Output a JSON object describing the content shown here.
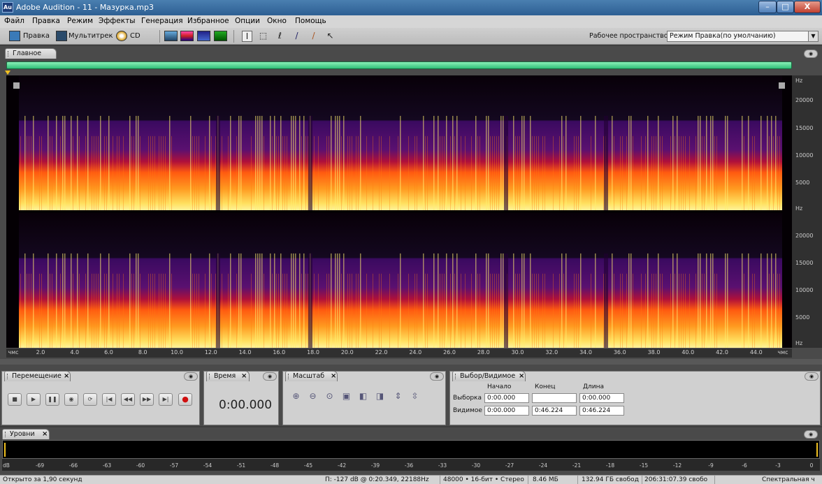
{
  "window": {
    "app_icon": "Au",
    "title": "Adobe Audition - 11 - Мазурка.mp3",
    "minimize": "–",
    "maximize": "□",
    "close": "X"
  },
  "menu": [
    "Файл",
    "Правка",
    "Режим",
    "Эффекты",
    "Генерация",
    "Избранное",
    "Опции",
    "Окно",
    "Помощь"
  ],
  "toolbar": {
    "edit_label": "Правка",
    "multitrack_label": "Мультитрек",
    "cd_label": "CD",
    "workspace_label": "Рабочее пространство:",
    "workspace_value": "Режим Правка(по умолчанию)"
  },
  "main_tab": {
    "label": "Главное"
  },
  "spectrogram": {
    "hz_unit": "Hz",
    "hz_labels": [
      "20000",
      "15000",
      "10000",
      "5000"
    ],
    "time_unit": "чмс",
    "time_ticks": [
      "2.0",
      "4.0",
      "6.0",
      "8.0",
      "10.0",
      "12.0",
      "14.0",
      "16.0",
      "18.0",
      "20.0",
      "22.0",
      "24.0",
      "26.0",
      "28.0",
      "30.0",
      "32.0",
      "34.0",
      "36.0",
      "38.0",
      "40.0",
      "42.0",
      "44.0"
    ],
    "colors": {
      "background": "#040004",
      "high": "#ffef70",
      "mid": "#ff7a10",
      "low": "#b0103a",
      "faint": "#3a0a60"
    }
  },
  "transport": {
    "tab_label": "Перемещение",
    "buttons": [
      "stop",
      "play",
      "pause",
      "play-from-cursor",
      "loop",
      "to-start",
      "rewind",
      "fast-forward",
      "to-end",
      "record"
    ]
  },
  "time_panel": {
    "tab_label": "Время",
    "value": "0:00.000"
  },
  "zoom_panel": {
    "tab_label": "Масштаб"
  },
  "selection_panel": {
    "tab_label": "Выбор/Видимое",
    "col_start": "Начало",
    "col_end": "Конец",
    "col_length": "Длина",
    "row_selection": "Выборка",
    "row_visible": "Видимое",
    "sel_start": "0:00.000",
    "sel_end": "",
    "sel_length": "0:00.000",
    "vis_start": "0:00.000",
    "vis_end": "0:46.224",
    "vis_length": "0:46.224"
  },
  "levels": {
    "tab_label": "Уровни",
    "db_labels": [
      "dB",
      "-69",
      "-66",
      "-63",
      "-60",
      "-57",
      "-54",
      "-51",
      "-48",
      "-45",
      "-42",
      "-39",
      "-36",
      "-33",
      "-30",
      "-27",
      "-24",
      "-21",
      "-18",
      "-15",
      "-12",
      "-9",
      "-6",
      "-3",
      "0"
    ]
  },
  "status": {
    "left": "Открыто за 1,90 секунд",
    "cursor": "П: -127 dB @  0:20.349, 22188Hz",
    "format": "48000 • 16-бит • Стерео",
    "size": "8.46 МБ",
    "free": "132.94 ГБ свобод",
    "free_time": "206:31:07.39 свобо",
    "view": "Спектральная ч"
  }
}
